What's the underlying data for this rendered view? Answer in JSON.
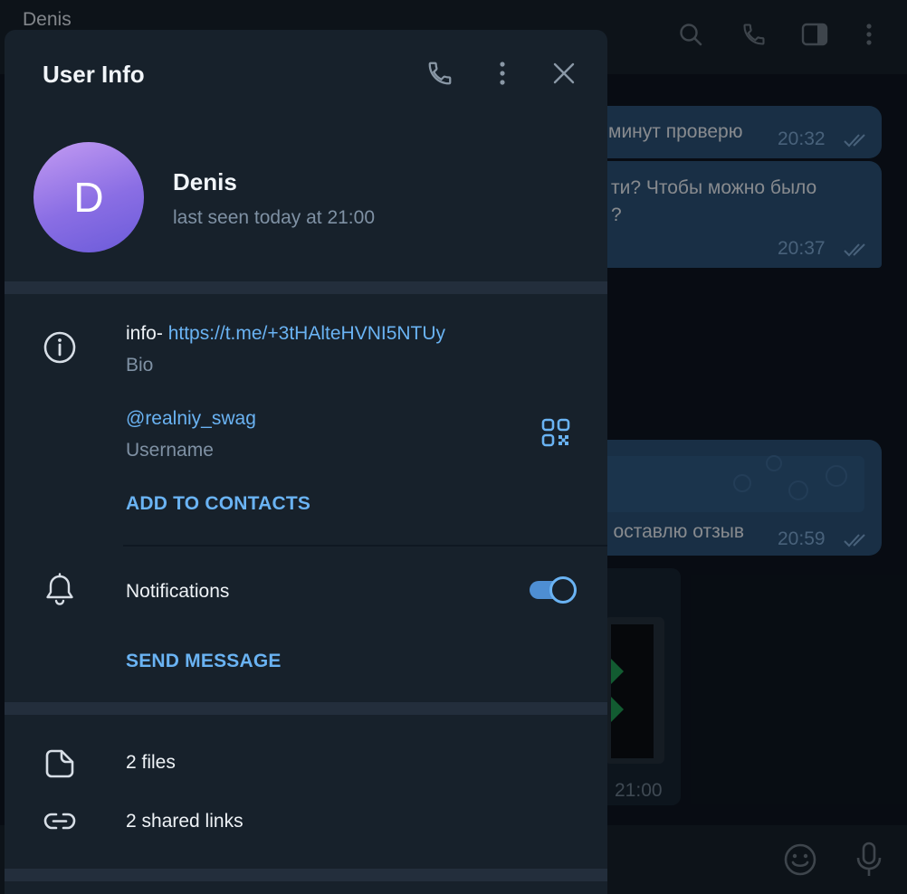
{
  "background_chat": {
    "title": "Denis",
    "messages": [
      {
        "text": "минут проверю",
        "time": "20:32"
      },
      {
        "text_line1": "ти? Чтобы можно было",
        "text_line2": "?",
        "time": "20:37"
      },
      {
        "text": "о оставлю отзыв",
        "time": "20:59"
      }
    ],
    "media_time": "21:00"
  },
  "panel": {
    "title": "User Info",
    "name": "Denis",
    "status": "last seen today at 21:00",
    "avatar_letter": "D",
    "bio": {
      "prefix": "info- ",
      "link": "https://t.me/+3tHAlteHVNI5NTUy",
      "label": "Bio"
    },
    "username": {
      "value": "@realniy_swag",
      "label": "Username"
    },
    "add_to_contacts": "ADD TO CONTACTS",
    "notifications": {
      "label": "Notifications",
      "enabled": true
    },
    "send_message": "SEND MESSAGE",
    "files": "2 files",
    "shared_links": "2 shared links"
  },
  "colors": {
    "accent": "#6ab3f3",
    "panel_bg": "#17212b",
    "bubble_out": "#2b5278"
  },
  "icons": [
    "search-icon",
    "phone-icon",
    "sidebar-toggle-icon",
    "more-vertical-icon",
    "close-icon",
    "info-icon",
    "qr-code-icon",
    "bell-icon",
    "file-icon",
    "link-icon",
    "emoji-icon",
    "microphone-icon"
  ]
}
